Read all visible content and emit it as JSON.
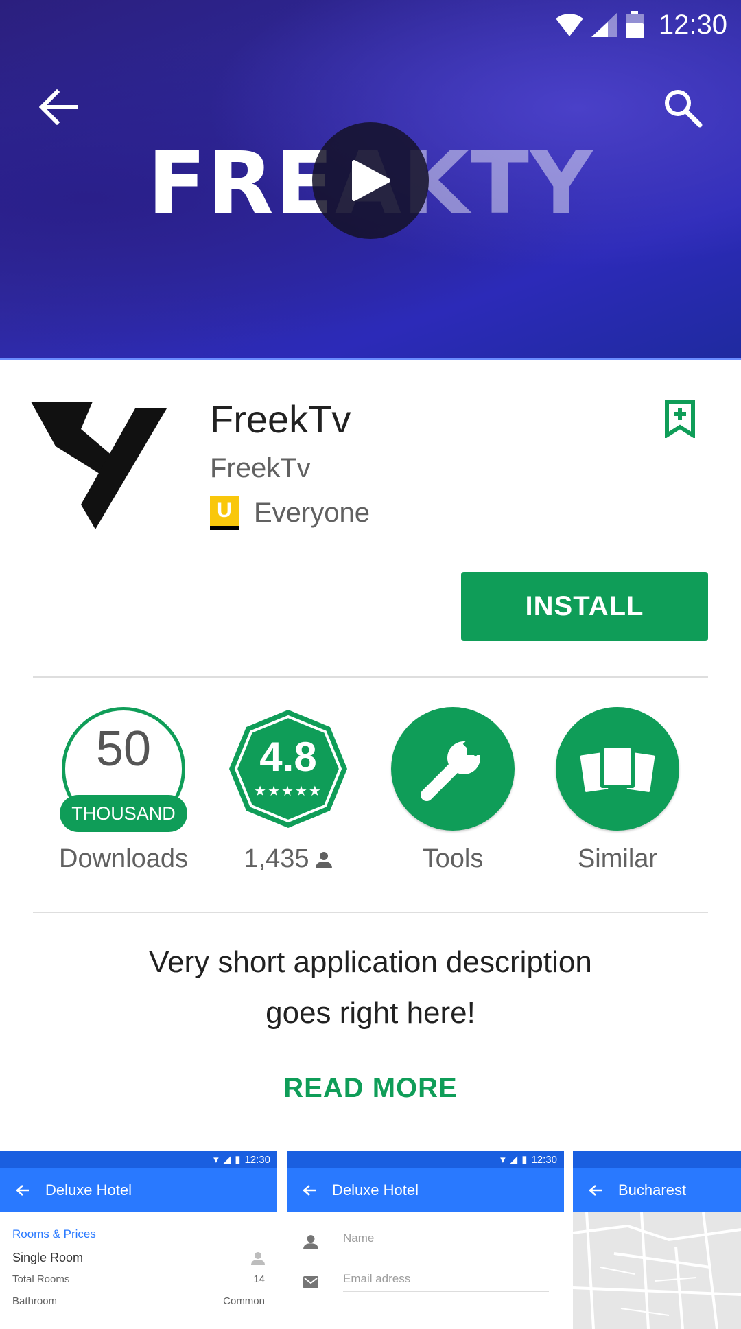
{
  "status_bar": {
    "time": "12:30"
  },
  "hero": {
    "title_main": "FRE",
    "title_faded": "AKTY"
  },
  "app": {
    "name": "FreekTv",
    "developer": "FreekTv",
    "content_rating_badge": "U",
    "content_rating": "Everyone",
    "install_label": "INSTALL"
  },
  "stats": {
    "downloads_number": "50",
    "downloads_unit": "THOUSAND",
    "downloads_label": "Downloads",
    "rating_value": "4.8",
    "rating_stars": "★★★★★",
    "rating_count": "1,435",
    "tools_label": "Tools",
    "similar_label": "Similar"
  },
  "description": {
    "line1": "Very short application description",
    "line2": "goes right here!",
    "read_more": "READ MORE"
  },
  "screenshots": [
    {
      "time": "12:30",
      "title": "Deluxe Hotel",
      "section": "Rooms & Prices",
      "room": "Single Room",
      "rows": [
        {
          "label": "Total Rooms",
          "value": "14"
        },
        {
          "label": "Bathroom",
          "value": "Common"
        }
      ]
    },
    {
      "time": "12:30",
      "title": "Deluxe Hotel",
      "field1": "Name",
      "field2": "Email adress"
    },
    {
      "title": "Bucharest"
    }
  ],
  "colors": {
    "accent_green": "#0f9d58",
    "screenshot_blue": "#2979ff",
    "rating_yellow": "#f9c70b"
  }
}
